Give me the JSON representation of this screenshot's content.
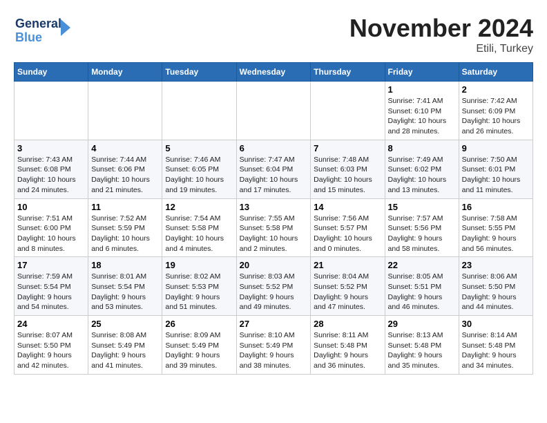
{
  "header": {
    "logo_line1": "General",
    "logo_line2": "Blue",
    "month_title": "November 2024",
    "subtitle": "Etili, Turkey"
  },
  "days_of_week": [
    "Sunday",
    "Monday",
    "Tuesday",
    "Wednesday",
    "Thursday",
    "Friday",
    "Saturday"
  ],
  "weeks": [
    [
      {
        "day": "",
        "info": ""
      },
      {
        "day": "",
        "info": ""
      },
      {
        "day": "",
        "info": ""
      },
      {
        "day": "",
        "info": ""
      },
      {
        "day": "",
        "info": ""
      },
      {
        "day": "1",
        "info": "Sunrise: 7:41 AM\nSunset: 6:10 PM\nDaylight: 10 hours and 28 minutes."
      },
      {
        "day": "2",
        "info": "Sunrise: 7:42 AM\nSunset: 6:09 PM\nDaylight: 10 hours and 26 minutes."
      }
    ],
    [
      {
        "day": "3",
        "info": "Sunrise: 7:43 AM\nSunset: 6:08 PM\nDaylight: 10 hours and 24 minutes."
      },
      {
        "day": "4",
        "info": "Sunrise: 7:44 AM\nSunset: 6:06 PM\nDaylight: 10 hours and 21 minutes."
      },
      {
        "day": "5",
        "info": "Sunrise: 7:46 AM\nSunset: 6:05 PM\nDaylight: 10 hours and 19 minutes."
      },
      {
        "day": "6",
        "info": "Sunrise: 7:47 AM\nSunset: 6:04 PM\nDaylight: 10 hours and 17 minutes."
      },
      {
        "day": "7",
        "info": "Sunrise: 7:48 AM\nSunset: 6:03 PM\nDaylight: 10 hours and 15 minutes."
      },
      {
        "day": "8",
        "info": "Sunrise: 7:49 AM\nSunset: 6:02 PM\nDaylight: 10 hours and 13 minutes."
      },
      {
        "day": "9",
        "info": "Sunrise: 7:50 AM\nSunset: 6:01 PM\nDaylight: 10 hours and 11 minutes."
      }
    ],
    [
      {
        "day": "10",
        "info": "Sunrise: 7:51 AM\nSunset: 6:00 PM\nDaylight: 10 hours and 8 minutes."
      },
      {
        "day": "11",
        "info": "Sunrise: 7:52 AM\nSunset: 5:59 PM\nDaylight: 10 hours and 6 minutes."
      },
      {
        "day": "12",
        "info": "Sunrise: 7:54 AM\nSunset: 5:58 PM\nDaylight: 10 hours and 4 minutes."
      },
      {
        "day": "13",
        "info": "Sunrise: 7:55 AM\nSunset: 5:58 PM\nDaylight: 10 hours and 2 minutes."
      },
      {
        "day": "14",
        "info": "Sunrise: 7:56 AM\nSunset: 5:57 PM\nDaylight: 10 hours and 0 minutes."
      },
      {
        "day": "15",
        "info": "Sunrise: 7:57 AM\nSunset: 5:56 PM\nDaylight: 9 hours and 58 minutes."
      },
      {
        "day": "16",
        "info": "Sunrise: 7:58 AM\nSunset: 5:55 PM\nDaylight: 9 hours and 56 minutes."
      }
    ],
    [
      {
        "day": "17",
        "info": "Sunrise: 7:59 AM\nSunset: 5:54 PM\nDaylight: 9 hours and 54 minutes."
      },
      {
        "day": "18",
        "info": "Sunrise: 8:01 AM\nSunset: 5:54 PM\nDaylight: 9 hours and 53 minutes."
      },
      {
        "day": "19",
        "info": "Sunrise: 8:02 AM\nSunset: 5:53 PM\nDaylight: 9 hours and 51 minutes."
      },
      {
        "day": "20",
        "info": "Sunrise: 8:03 AM\nSunset: 5:52 PM\nDaylight: 9 hours and 49 minutes."
      },
      {
        "day": "21",
        "info": "Sunrise: 8:04 AM\nSunset: 5:52 PM\nDaylight: 9 hours and 47 minutes."
      },
      {
        "day": "22",
        "info": "Sunrise: 8:05 AM\nSunset: 5:51 PM\nDaylight: 9 hours and 46 minutes."
      },
      {
        "day": "23",
        "info": "Sunrise: 8:06 AM\nSunset: 5:50 PM\nDaylight: 9 hours and 44 minutes."
      }
    ],
    [
      {
        "day": "24",
        "info": "Sunrise: 8:07 AM\nSunset: 5:50 PM\nDaylight: 9 hours and 42 minutes."
      },
      {
        "day": "25",
        "info": "Sunrise: 8:08 AM\nSunset: 5:49 PM\nDaylight: 9 hours and 41 minutes."
      },
      {
        "day": "26",
        "info": "Sunrise: 8:09 AM\nSunset: 5:49 PM\nDaylight: 9 hours and 39 minutes."
      },
      {
        "day": "27",
        "info": "Sunrise: 8:10 AM\nSunset: 5:49 PM\nDaylight: 9 hours and 38 minutes."
      },
      {
        "day": "28",
        "info": "Sunrise: 8:11 AM\nSunset: 5:48 PM\nDaylight: 9 hours and 36 minutes."
      },
      {
        "day": "29",
        "info": "Sunrise: 8:13 AM\nSunset: 5:48 PM\nDaylight: 9 hours and 35 minutes."
      },
      {
        "day": "30",
        "info": "Sunrise: 8:14 AM\nSunset: 5:48 PM\nDaylight: 9 hours and 34 minutes."
      }
    ]
  ]
}
